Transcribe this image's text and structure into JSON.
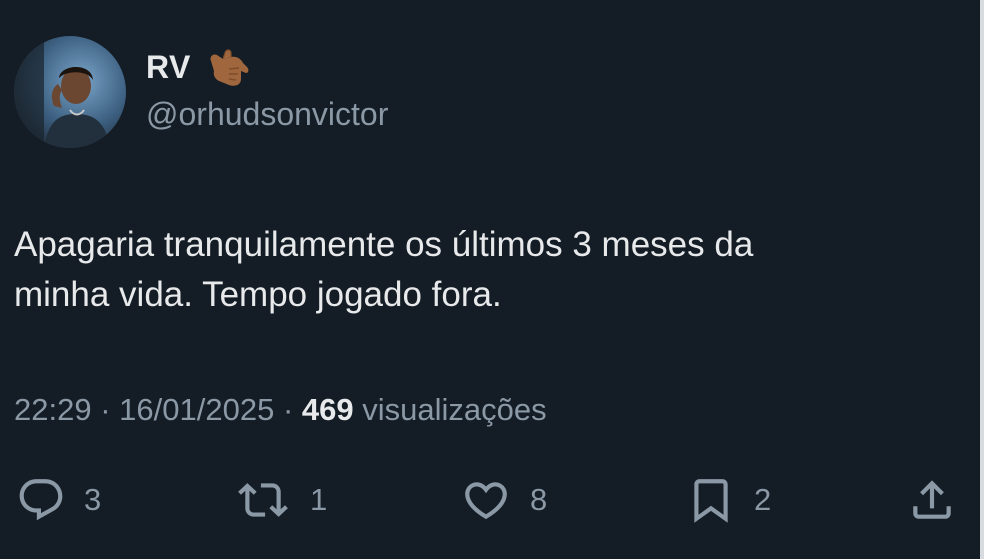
{
  "author": {
    "display_name": "RV",
    "name_emoji": "call-me-hand-emoji",
    "handle": "@orhudsonvictor",
    "avatar": "profile-photo"
  },
  "tweet": {
    "text_line1": "Apagaria tranquilamente os últimos 3 meses da",
    "text_line2": "minha vida. Tempo jogado fora."
  },
  "meta": {
    "time": "22:29",
    "separator": "·",
    "date": "16/01/2025",
    "views_count": "469",
    "views_label": "visualizações"
  },
  "actions": {
    "replies": "3",
    "retweets": "1",
    "likes": "8",
    "bookmarks": "2"
  },
  "colors": {
    "background": "#141d26",
    "text": "#e7e9ea",
    "muted": "#8b98a5"
  }
}
